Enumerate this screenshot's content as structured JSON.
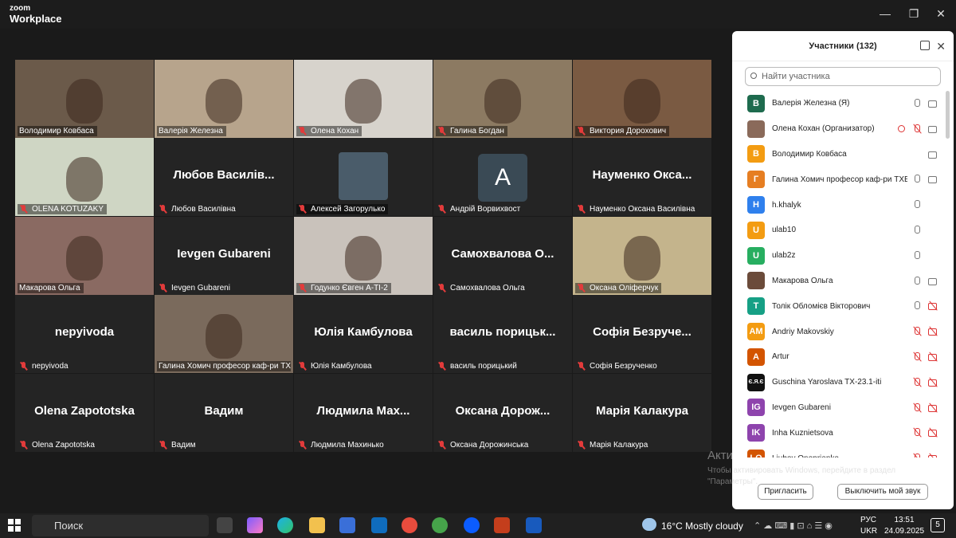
{
  "app": {
    "brand_line1": "zoom",
    "brand_line2": "Workplace"
  },
  "tiles": [
    {
      "label": "Володимир Ковбаса",
      "big": "",
      "video": true,
      "muted": false
    },
    {
      "label": "Валерія Железна",
      "big": "",
      "video": true,
      "muted": false
    },
    {
      "label": "Олена Кохан",
      "big": "",
      "video": true,
      "muted": true
    },
    {
      "label": "Галина Богдан",
      "big": "",
      "video": true,
      "muted": true
    },
    {
      "label": "Виктория Дорохович",
      "big": "",
      "video": true,
      "muted": true
    },
    {
      "label": "OLENA KOTUZAKY",
      "big": "",
      "video": true,
      "muted": true
    },
    {
      "label": "Любов Василівна",
      "big": "Любов Василів...",
      "video": false,
      "muted": true
    },
    {
      "label": "Алексей Загорулько",
      "big": "",
      "video": true,
      "muted": true
    },
    {
      "label": "Андрій Ворвихвост",
      "big": "A",
      "video": false,
      "muted": true
    },
    {
      "label": "Науменко Оксана Василівна",
      "big": "Науменко Окса...",
      "video": false,
      "muted": true
    },
    {
      "label": "Макарова Ольга",
      "big": "",
      "video": true,
      "muted": false
    },
    {
      "label": "Ievgen Gubareni",
      "big": "Ievgen Gubareni",
      "video": false,
      "muted": true
    },
    {
      "label": "Годунко Євген А-ТІ-2",
      "big": "",
      "video": true,
      "muted": true
    },
    {
      "label": "Самохвалова Ольга",
      "big": "Самохвалова О...",
      "video": false,
      "muted": true
    },
    {
      "label": "Оксана Оліферчук",
      "big": "",
      "video": true,
      "muted": true
    },
    {
      "label": "nepyivoda",
      "big": "nepyivoda",
      "video": false,
      "muted": true
    },
    {
      "label": "Галина Хомич професор каф-ри ТХВ...",
      "big": "",
      "video": true,
      "muted": false
    },
    {
      "label": "Юлія Камбулова",
      "big": "Юлія Камбулова",
      "video": false,
      "muted": true
    },
    {
      "label": "василь порицький",
      "big": "василь порицьк...",
      "video": false,
      "muted": true
    },
    {
      "label": "Софія Безрученко",
      "big": "Софія Безруче...",
      "video": false,
      "muted": true
    },
    {
      "label": "Olena Zapototska",
      "big": "Olena Zapototska",
      "video": false,
      "muted": true
    },
    {
      "label": "Вадим",
      "big": "Вадим",
      "video": false,
      "muted": true
    },
    {
      "label": "Людмила Махинько",
      "big": "Людмила Мах...",
      "video": false,
      "muted": true
    },
    {
      "label": "Оксана Дорожинська",
      "big": "Оксана Дорож...",
      "video": false,
      "muted": true
    },
    {
      "label": "Марія Калакура",
      "big": "Марія Калакура",
      "video": false,
      "muted": true
    }
  ],
  "panel": {
    "title": "Участники (132)",
    "search_placeholder": "Найти участника",
    "invite": "Пригласить",
    "mute_me": "Выключить мой звук",
    "participants": [
      {
        "initials": "В",
        "name": "Валерія Железна (Я)",
        "color": "#1e6b4e",
        "mic": "ok",
        "cam": "ok"
      },
      {
        "initials": "",
        "name": "Олена Кохан (Организатор)",
        "color": "#8a6a5a",
        "mic": "off",
        "cam": "ok",
        "rec": true
      },
      {
        "initials": "В",
        "name": "Володимир Ковбаса",
        "color": "#f39c12",
        "mic": "none",
        "cam": "ok"
      },
      {
        "initials": "Г",
        "name": "Галина Хомич професор каф-ри ТХВ...",
        "color": "#e67e22",
        "mic": "ok",
        "cam": "ok"
      },
      {
        "initials": "H",
        "name": "h.khalyk",
        "color": "#2f80ed",
        "mic": "ok",
        "cam": "none"
      },
      {
        "initials": "U",
        "name": "ulab10",
        "color": "#f39c12",
        "mic": "ok",
        "cam": "none"
      },
      {
        "initials": "U",
        "name": "ulab2z",
        "color": "#27ae60",
        "mic": "ok",
        "cam": "none"
      },
      {
        "initials": "",
        "name": "Макарова Ольга",
        "color": "#6b4b3a",
        "mic": "ok",
        "cam": "ok"
      },
      {
        "initials": "T",
        "name": "Толік Обломієв Вікторович",
        "color": "#16a085",
        "mic": "ok",
        "cam": "off"
      },
      {
        "initials": "AM",
        "name": "Andriy Makovskiy",
        "color": "#f39c12",
        "mic": "off",
        "cam": "off"
      },
      {
        "initials": "A",
        "name": "Artur",
        "color": "#d35400",
        "mic": "off",
        "cam": "off"
      },
      {
        "initials": "Є.Я.Є",
        "name": "Guschina Yaroslava TX-23.1-iti",
        "color": "#111111",
        "mic": "off",
        "cam": "off"
      },
      {
        "initials": "IG",
        "name": "Ievgen Gubareni",
        "color": "#8e44ad",
        "mic": "off",
        "cam": "off"
      },
      {
        "initials": "IK",
        "name": "Inha Kuznietsova",
        "color": "#8e44ad",
        "mic": "off",
        "cam": "off"
      },
      {
        "initials": "LO",
        "name": "Liubov Onoprienko",
        "color": "#d35400",
        "mic": "off",
        "cam": "off"
      }
    ]
  },
  "watermark": {
    "line1": "Актива...",
    "line2": "Чтобы активировать Windows, перейдите в раздел",
    "line3": "\"Параметры\"."
  },
  "taskbar": {
    "search": "Поиск",
    "weather": "16°C  Mostly cloudy",
    "lang1": "РУС",
    "lang2": "UKR",
    "time": "13:51",
    "date": "24.09.2025",
    "notif": "5"
  }
}
